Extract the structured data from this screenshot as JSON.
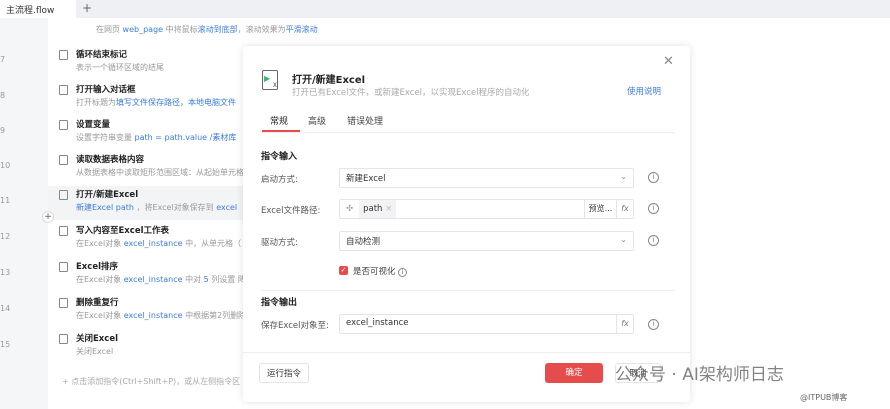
{
  "tabbar": {
    "tab": "主流程.flow",
    "add": "+"
  },
  "line_numbers": [
    "7",
    "8",
    "9",
    "10",
    "11",
    "12",
    "13",
    "14",
    "15"
  ],
  "top_desc": {
    "a": "在网页 ",
    "b": "web_page",
    "c": " 中将鼠标",
    "d": "滚动到底部",
    "e": "，滚动效果为",
    "f": "平滑滚动"
  },
  "steps": [
    {
      "title": "循环结束标记",
      "desc": "表示一个循环区域的结尾"
    },
    {
      "title": "打开输入对话框",
      "desc_a": "打开标题为",
      "desc_b": "填写文件保存路径，本地电脑文件"
    },
    {
      "title": "设置变量",
      "desc_a": "设置字符串变量 ",
      "desc_b": "path = path.value /素材库"
    },
    {
      "title": "读取数据表格内容",
      "desc": "从数据表格中读取矩形范围区域：从起始单元格"
    },
    {
      "title": "打开/新建Excel",
      "desc_a": "新建Excel",
      "desc_b": " path ",
      "desc_c": "，将Excel对象保存到 ",
      "desc_d": "excel"
    },
    {
      "title": "写入内容至Excel工作表",
      "desc_a": "在Excel对象 ",
      "desc_b": "excel_instance",
      "desc_c": " 中，从单元格（"
    },
    {
      "title": "Excel排序",
      "desc_a": "在Excel对象 ",
      "desc_b": "excel_instance",
      "desc_c": " 中对 ",
      "desc_d": "5",
      "desc_e": " 列设置 降"
    },
    {
      "title": "删除重复行",
      "desc_a": "在Excel对象 ",
      "desc_b": "excel_instance",
      "desc_c": " 中根据第2列删除"
    },
    {
      "title": "关闭Excel",
      "desc": "关闭Excel"
    }
  ],
  "hint": "+  点击添加指令(Ctrl+Shift+P)，或从左侧指令区",
  "dialog": {
    "title": "打开/新建Excel",
    "subtitle": "打开已有Excel文件，或新建Excel，以实现Excel程序的自动化",
    "help": "使用说明",
    "tabs": [
      "常规",
      "高级",
      "错误处理"
    ],
    "input_section": "指令输入",
    "launch_label": "启动方式:",
    "launch_value": "新建Excel",
    "path_label": "Excel文件路径:",
    "path_value": "path",
    "preview": "预览...",
    "driver_label": "驱动方式:",
    "driver_value": "自动检测",
    "visible_label": "是否可视化",
    "output_section": "指令输出",
    "save_label": "保存Excel对象至:",
    "save_value": "excel_instance",
    "run": "运行指令",
    "ok": "确定",
    "cancel": "取消"
  },
  "watermark": {
    "text": "公众号 · AI架构师日志",
    "site": "@ITPUB博客"
  },
  "colors": {
    "accent": "#e54d4d",
    "link": "#3b7ddd"
  }
}
